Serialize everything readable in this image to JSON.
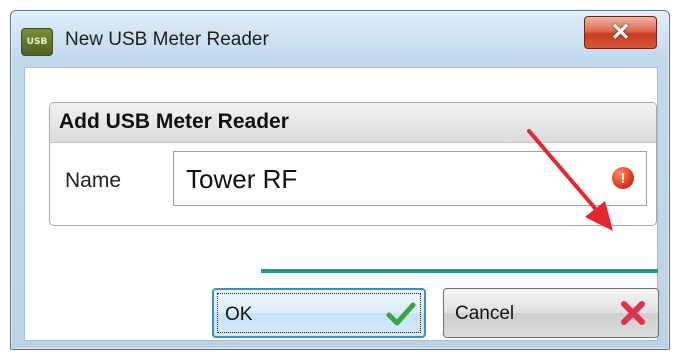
{
  "window": {
    "title": "New USB Meter Reader",
    "icon_text": "USB",
    "close_glyph": "✕"
  },
  "group": {
    "title": "Add USB Meter Reader"
  },
  "form": {
    "name_label": "Name",
    "name_value": "Tower RF",
    "error_glyph": "!"
  },
  "progress": {
    "fraction": 1.0
  },
  "buttons": {
    "ok_label": "OK",
    "cancel_label": "Cancel"
  },
  "colors": {
    "progress": "#1f9a92",
    "arrow": "#e8242f",
    "ok_check": "#3aa53a",
    "cancel_x": "#e03248",
    "close_button": "#c83b1f"
  },
  "icons": {
    "window": "usb-app-icon",
    "close": "close-icon",
    "validation": "error-icon",
    "annotation": "red-arrow-icon",
    "ok": "checkmark-icon",
    "cancel": "red-x-icon"
  }
}
